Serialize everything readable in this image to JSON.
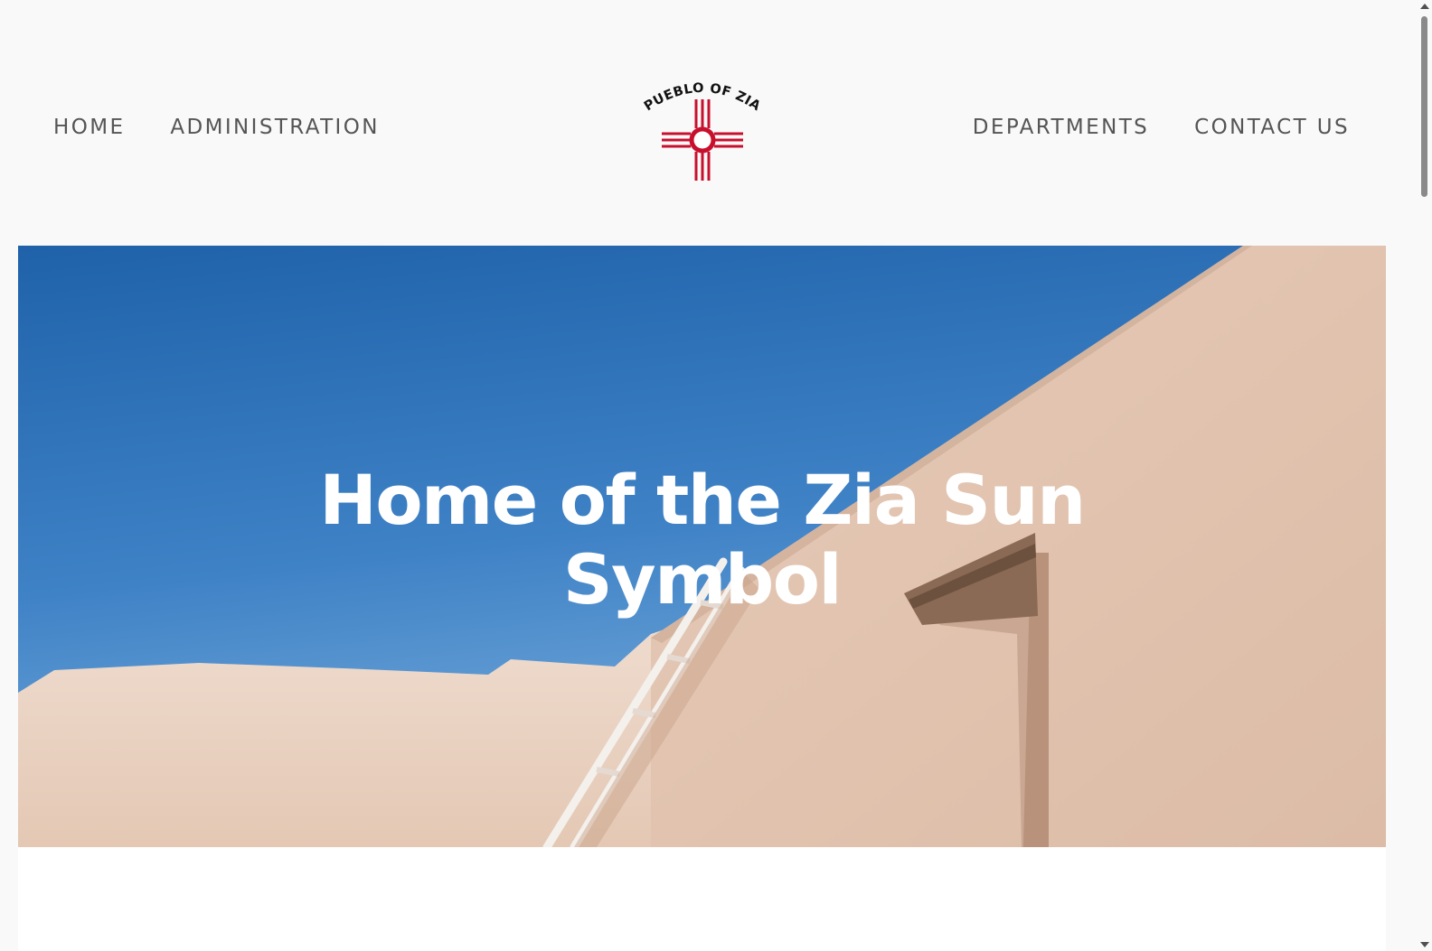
{
  "nav": {
    "left": [
      {
        "label": "HOME"
      },
      {
        "label": "ADMINISTRATION"
      }
    ],
    "right": [
      {
        "label": "DEPARTMENTS"
      },
      {
        "label": "CONTACT US"
      }
    ]
  },
  "logo": {
    "text": "PUEBLO OF ZIA",
    "symbol_color": "#c8102e",
    "icon": "zia-sun-icon"
  },
  "hero": {
    "title_line1": "Home of the Zia Sun",
    "title_line2": "Symbol",
    "sky_color": "#2f74bd",
    "wall_color": "#e7cbb8"
  }
}
